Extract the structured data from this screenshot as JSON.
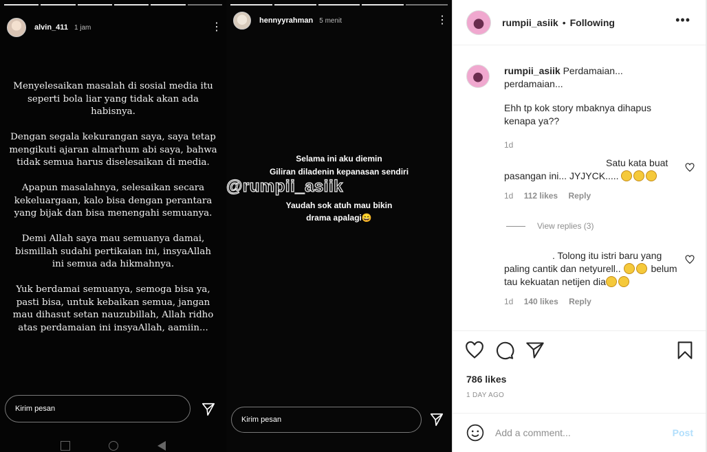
{
  "story1": {
    "progress_segments": 6,
    "username": "alvin_411",
    "time": "1 jam",
    "paragraphs": [
      "Menyelesaikan masalah di sosial media itu seperti bola liar yang tidak akan ada habisnya.",
      "Dengan segala kekurangan saya, saya tetap mengikuti ajaran almarhum abi saya, bahwa tidak semua harus diselesaikan di media.",
      "Apapun masalahnya, selesaikan secara kekeluargaan, kalo bisa dengan perantara yang bijak dan bisa menengahi semuanya.",
      "Demi Allah saya mau semuanya damai, bismillah sudahi pertikaian ini, insyaAllah ini semua ada hikmahnya.",
      "Yuk berdamai semuanya, semoga bisa ya, pasti bisa, untuk kebaikan semua, jangan mau dihasut setan nauzubillah, Allah ridho atas perdamaian ini insyaAllah, aamiin..."
    ],
    "message_placeholder": "Kirim pesan"
  },
  "story2": {
    "progress_segments": 5,
    "username": "hennyyrahman",
    "time": "5 menit",
    "lines": [
      "Selama ini aku diemin",
      "Giliran diladenin kepanasan sendiri",
      "Yaudah sok atuh mau bikin",
      "drama apalagi😄"
    ],
    "watermark": "@rumpii_asiik",
    "message_placeholder": "Kirim pesan"
  },
  "post": {
    "username": "rumpii_asiik",
    "separator": "•",
    "follow_status": "Following",
    "more_icon": "more-horizontal-icon",
    "caption": {
      "username": "rumpii_asiik",
      "text_head": "Perdamaian... perdamaian...",
      "text_body": "Ehh tp kok story mbaknya dihapus kenapa ya??",
      "age": "1d"
    },
    "comments": [
      {
        "text": "Satu kata buat pasangan ini... JYJYCK.....",
        "emoji_count": 3,
        "age": "1d",
        "likes": "112 likes",
        "reply": "Reply",
        "view_replies": "View replies (3)"
      },
      {
        "text_a": ". Tolong itu istri baru yang paling cantik dan netyurell..",
        "text_b": "belum tau kekuatan netijen",
        "text_c": "dia",
        "age": "1d",
        "likes": "140 likes",
        "reply": "Reply"
      }
    ],
    "likes": "786 likes",
    "posted_ago": "1 DAY AGO",
    "add_comment_placeholder": "Add a comment...",
    "post_button": "Post"
  }
}
